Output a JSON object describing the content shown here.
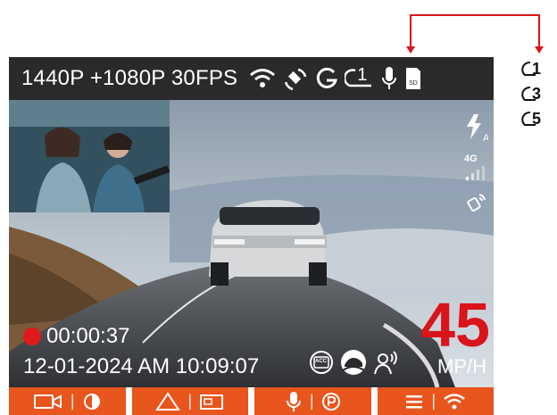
{
  "header": {
    "resolution_text": "1440P +1080P 30FPS",
    "icons": [
      "wifi-icon",
      "gps-icon",
      "g-sensor-icon",
      "loop-recording-icon",
      "microphone-icon",
      "sd-card-icon"
    ],
    "loop_value": "1"
  },
  "right_panel": {
    "icons": [
      "flash-auto-icon",
      "signal-4g-icon",
      "gps-satellite-icon"
    ],
    "signal_label": "4G"
  },
  "recording": {
    "time": "00:00:37"
  },
  "datetime": "12-01-2024 AM 10:09:07",
  "speed": {
    "value": "45",
    "unit": "MP/H",
    "color": "#d9141a"
  },
  "status_icons": [
    "acc-icon",
    "parking-mode-icon",
    "voice-control-icon"
  ],
  "status_icon_labels": {
    "acc": "ACC"
  },
  "bottom_buttons": [
    {
      "name": "video-camera-button",
      "left_icon": "video-camera-icon",
      "right_icon": "screen-off-icon"
    },
    {
      "name": "emergency-button",
      "left_icon": "warning-triangle-icon",
      "right_icon": "camera-switch-icon"
    },
    {
      "name": "microphone-button",
      "left_icon": "microphone-icon",
      "right_icon": "parking-icon"
    },
    {
      "name": "menu-button",
      "left_icon": "menu-icon",
      "right_icon": "wifi-icon"
    }
  ],
  "loop_options": [
    "1",
    "3",
    "5"
  ],
  "colors": {
    "accent": "#e8551d",
    "record": "#e0191c",
    "topbar": "#2a2a2c",
    "annotation": "#d9141a"
  }
}
